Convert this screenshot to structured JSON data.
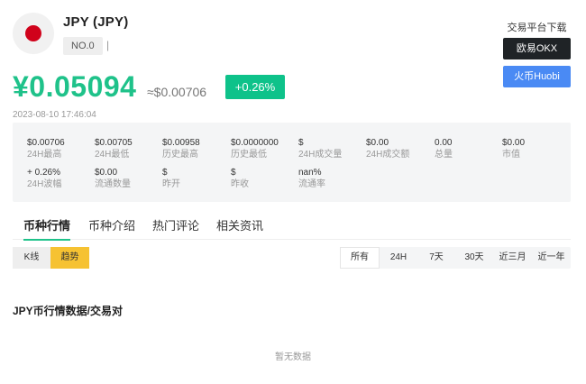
{
  "header": {
    "coin_name": "JPY (JPY)",
    "rank": "NO.0",
    "rank_separator": "|",
    "price": "¥0.05094",
    "price_usd": "≈$0.00706",
    "change": "+0.26%",
    "timestamp": "2023-08-10 17:46:04",
    "change_color": "#0ec28a",
    "flag_color": "#d0021b"
  },
  "exchange": {
    "title": "交易平台下载",
    "okx_label": "欧易OKX",
    "huobi_label": "火币Huobi"
  },
  "stats": {
    "row1": [
      {
        "value": "$0.00706",
        "label": "24H最高"
      },
      {
        "value": "$0.00705",
        "label": "24H最低"
      },
      {
        "value": "$0.00958",
        "label": "历史最高"
      },
      {
        "value": "$0.0000000",
        "label": "历史最低"
      },
      {
        "value": "$",
        "label": "24H成交量"
      },
      {
        "value": "$0.00",
        "label": "24H成交额"
      },
      {
        "value": "0.00",
        "label": "总量"
      },
      {
        "value": "$0.00",
        "label": "市值"
      }
    ],
    "row2": [
      {
        "value": "+ 0.26%",
        "label": "24H波幅"
      },
      {
        "value": "$0.00",
        "label": "流通数量"
      },
      {
        "value": "$",
        "label": "昨开"
      },
      {
        "value": "$",
        "label": "昨收"
      },
      {
        "value": "nan%",
        "label": "流通率"
      }
    ]
  },
  "tabs": [
    "币种行情",
    "币种介绍",
    "热门评论",
    "相关资讯"
  ],
  "chart_toggle": {
    "kline": "K线",
    "trend": "趋势"
  },
  "ranges": [
    "所有",
    "24H",
    "7天",
    "30天",
    "近三月",
    "近一年"
  ],
  "market": {
    "title": "JPY币行情数据/交易对",
    "empty": "暂无数据"
  }
}
